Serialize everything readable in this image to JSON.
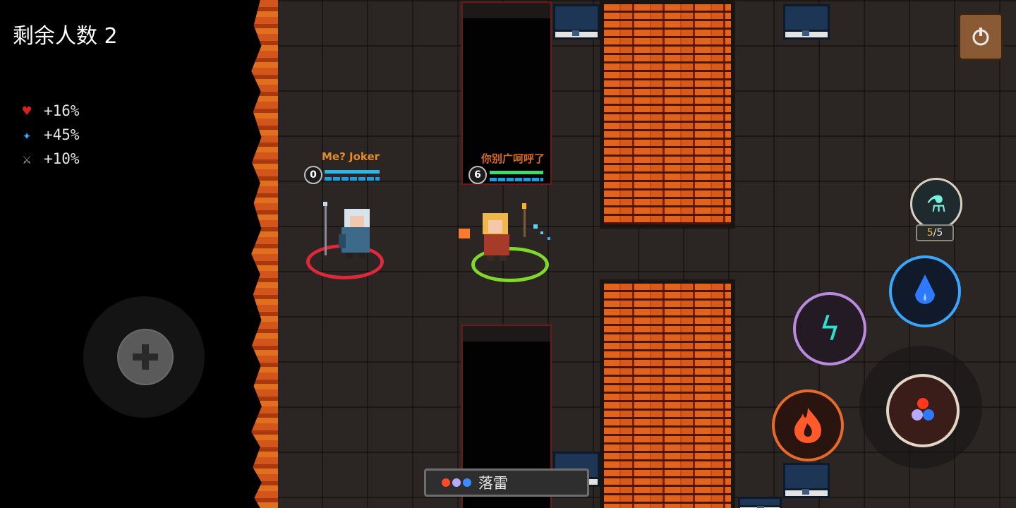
{
  "hud": {
    "remaining_label": "剩余人数 2"
  },
  "buffs": [
    {
      "icon": "heart-icon",
      "glyph": "♥",
      "color": "#e02020",
      "value": "+16%"
    },
    {
      "icon": "mana-icon",
      "glyph": "✦",
      "color": "#3aa7ff",
      "value": "+45%"
    },
    {
      "icon": "sword-icon",
      "glyph": "⚔",
      "color": "#b0b0b0",
      "value": "+10%"
    }
  ],
  "players": [
    {
      "name": "Me? Joker",
      "level": "0",
      "name_color": "#e38b2a",
      "ring_color": "#e0283a"
    },
    {
      "name": "你别广呵呼了",
      "level": "6",
      "name_color": "#d86a28",
      "ring_color": "#7fd82a"
    }
  ],
  "potion": {
    "icon": "potion-icon",
    "count_current": "5",
    "count_sep": "/",
    "count_max": "5"
  },
  "skills": {
    "lightning_icon": "lightning-icon",
    "water_icon": "water-drop-icon",
    "fire_icon": "fire-icon",
    "combo_icon": "element-combo-icon"
  },
  "spell_bar": {
    "label": "落雷",
    "dot_colors": [
      "#ff4a2a",
      "#b8a8ff",
      "#3a8cff"
    ]
  },
  "colors": {
    "lava": "#d2561b",
    "brick": "#c9481a",
    "floor": "#2b2523"
  }
}
